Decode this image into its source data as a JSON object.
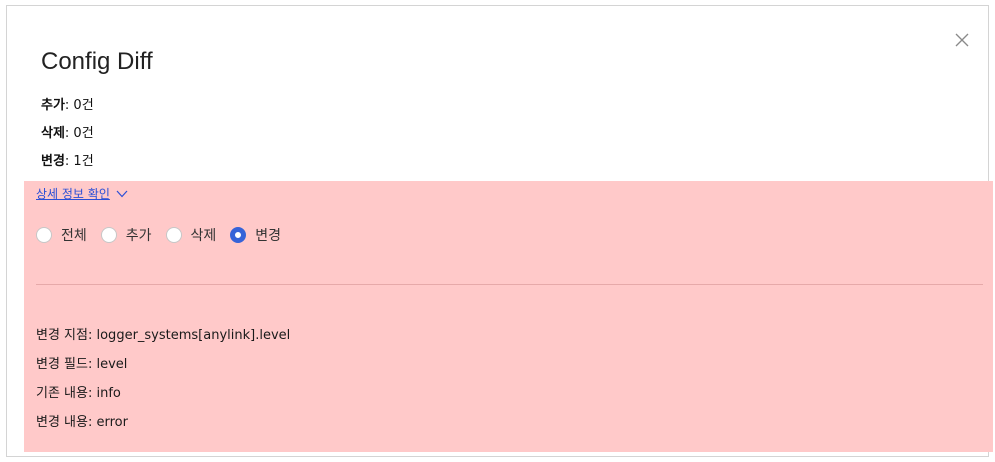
{
  "dialog": {
    "title": "Config Diff",
    "close_icon": "close-icon"
  },
  "summary": {
    "added": {
      "label": "추가",
      "value": ": 0건"
    },
    "deleted": {
      "label": "삭제",
      "value": ": 0건"
    },
    "changed": {
      "label": "변경",
      "value": ": 1건"
    }
  },
  "panel": {
    "background": "#ffc9c9",
    "detail_link_label": "상세 정보 확인",
    "detail_link_icon": "chevron-down-icon",
    "filters": [
      {
        "label": "전체",
        "selected": false
      },
      {
        "label": "추가",
        "selected": false
      },
      {
        "label": "삭제",
        "selected": false
      },
      {
        "label": "변경",
        "selected": true
      }
    ],
    "details": [
      {
        "label": "변경 지점",
        "value": ": logger_systems[anylink].level"
      },
      {
        "label": "변경 필드",
        "value": ": level"
      },
      {
        "label": "기존 내용",
        "value": ": info"
      },
      {
        "label": "변경 내용",
        "value": ": error"
      }
    ]
  },
  "colors": {
    "accent": "#3563d8",
    "link": "#2b4fd6"
  }
}
